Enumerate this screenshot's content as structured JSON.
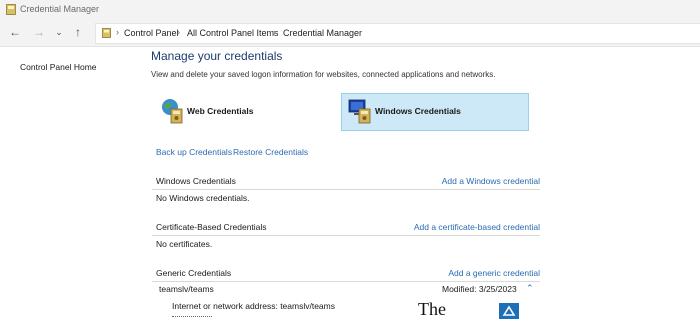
{
  "window": {
    "title": "Credential Manager"
  },
  "address": {
    "crumbs": [
      "Control Panel",
      "All Control Panel Items",
      "Credential Manager"
    ]
  },
  "sidebar": {
    "home_link": "Control Panel Home"
  },
  "main": {
    "title": "Manage your credentials",
    "subtitle": "View and delete your saved logon information for websites, connected applications and networks.",
    "tiles": {
      "web": "Web Credentials",
      "windows": "Windows Credentials"
    },
    "backup_link": "Back up Credentials",
    "restore_link": "Restore Credentials",
    "sections": {
      "windows": {
        "title": "Windows Credentials",
        "action": "Add a Windows credential",
        "empty": "No Windows credentials."
      },
      "certificate": {
        "title": "Certificate-Based Credentials",
        "action": "Add a certificate-based credential",
        "empty": "No certificates."
      },
      "generic": {
        "title": "Generic Credentials",
        "action": "Add a generic credential",
        "items": [
          {
            "name": "teamslv/teams",
            "modified": "Modified:  3/25/2023",
            "address_line": "Internet or network address:  teamslv/teams"
          }
        ]
      }
    }
  },
  "watermark": {
    "text": "The"
  },
  "colors": {
    "link": "#2b6cb3",
    "selected_tile": "#cde8f7",
    "title": "#1c3d6e"
  }
}
